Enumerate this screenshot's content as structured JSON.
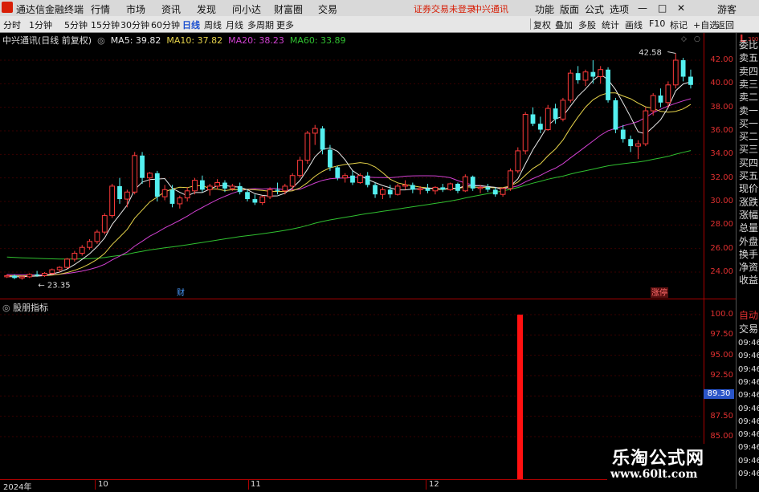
{
  "menubar": {
    "app_title": "通达信金融终端",
    "items": [
      "行情",
      "市场",
      "资讯",
      "发现",
      "问小达",
      "财富圈",
      "交易"
    ],
    "status_warning": "证券交易未登录",
    "stock_name": "中兴通讯",
    "right_items": [
      "功能",
      "版面",
      "公式",
      "选项"
    ],
    "guest": "游客"
  },
  "toolbar": {
    "periods": [
      "分时",
      "1分钟",
      "5分钟",
      "15分钟",
      "30分钟",
      "60分钟",
      "日线",
      "周线",
      "月线",
      "多周期",
      "更多"
    ],
    "right_buttons": [
      "复权",
      "叠加",
      "多股",
      "统计",
      "画线",
      "F10",
      "标记",
      "+自选",
      "返回"
    ],
    "active_period": "日线"
  },
  "main_chart": {
    "title": "中兴通讯(日线 前复权)",
    "ma": [
      {
        "label": "MA5: 39.82",
        "color": "#e8e8e8"
      },
      {
        "label": "MA10: 37.82",
        "color": "#e6d34a"
      },
      {
        "label": "MA20: 38.23",
        "color": "#d040d0"
      },
      {
        "label": "MA60: 33.89",
        "color": "#30c030"
      }
    ],
    "high_label": "42.58",
    "low_label": "23.35",
    "event_marks": [
      "财",
      "涨停"
    ],
    "price_ticks": [
      "42.00",
      "40.00",
      "38.00",
      "36.00",
      "34.00",
      "32.00",
      "30.00",
      "28.00",
      "26.00",
      "24.00"
    ]
  },
  "indicator": {
    "title": "股朋指标",
    "ticks": [
      "100.0",
      "97.50",
      "95.00",
      "92.50",
      "90.00",
      "87.50",
      "85.00"
    ],
    "current_value": "89.30"
  },
  "side_panel": {
    "order_book": [
      "委比",
      "卖五",
      "卖四",
      "卖三",
      "卖二",
      "卖一",
      "买一",
      "买二",
      "买三",
      "买四",
      "买五",
      "现价",
      "涨跌",
      "涨幅",
      "总量",
      "外盘",
      "换手",
      "净资",
      "收益"
    ],
    "lower": [
      "自动",
      "交易"
    ],
    "times": [
      "09:46",
      "09:46",
      "09:46",
      "09:46",
      "09:46",
      "09:46",
      "09:46",
      "09:46",
      "09:46",
      "09:46",
      "09:46"
    ],
    "top_badge": "L",
    "top_code": "300"
  },
  "date_axis": [
    "2024年",
    "10",
    "11",
    "12"
  ],
  "watermark": {
    "line1": "乐淘公式网",
    "line2": "www.60lt.com"
  },
  "chart_data": {
    "type": "candlestick",
    "title": "中兴通讯(日线 前复权)",
    "ylim": [
      22.5,
      43.5
    ],
    "candles": [
      [
        23.6,
        23.8,
        23.5,
        23.7
      ],
      [
        23.7,
        23.8,
        23.4,
        23.5
      ],
      [
        23.5,
        23.7,
        23.35,
        23.6
      ],
      [
        23.6,
        23.9,
        23.5,
        23.8
      ],
      [
        23.8,
        24.1,
        23.6,
        23.7
      ],
      [
        23.7,
        24.0,
        23.6,
        23.9
      ],
      [
        23.9,
        24.3,
        23.8,
        24.2
      ],
      [
        24.2,
        24.5,
        24.0,
        24.4
      ],
      [
        24.4,
        25.2,
        24.3,
        25.1
      ],
      [
        25.1,
        25.8,
        24.9,
        25.6
      ],
      [
        25.6,
        26.3,
        25.4,
        26.1
      ],
      [
        26.1,
        26.8,
        25.9,
        26.6
      ],
      [
        26.6,
        27.6,
        26.4,
        27.4
      ],
      [
        27.4,
        29.0,
        27.2,
        28.8
      ],
      [
        28.8,
        31.5,
        28.6,
        31.3
      ],
      [
        31.3,
        32.0,
        29.8,
        30.2
      ],
      [
        30.2,
        31.0,
        29.5,
        30.8
      ],
      [
        30.8,
        34.2,
        30.6,
        33.9
      ],
      [
        33.9,
        34.2,
        31.5,
        32.0
      ],
      [
        32.0,
        32.5,
        31.2,
        32.4
      ],
      [
        32.4,
        32.6,
        30.0,
        30.4
      ],
      [
        30.4,
        31.4,
        30.1,
        31.0
      ],
      [
        31.0,
        31.4,
        29.5,
        29.8
      ],
      [
        29.8,
        30.5,
        29.4,
        30.3
      ],
      [
        30.3,
        31.2,
        30.0,
        30.9
      ],
      [
        30.9,
        32.0,
        30.6,
        31.8
      ],
      [
        31.8,
        32.2,
        30.8,
        31.0
      ],
      [
        31.0,
        31.5,
        30.5,
        31.3
      ],
      [
        31.3,
        31.9,
        31.0,
        31.6
      ],
      [
        31.6,
        31.8,
        30.8,
        31.1
      ],
      [
        31.1,
        31.5,
        30.9,
        31.3
      ],
      [
        31.3,
        31.6,
        30.6,
        30.8
      ],
      [
        30.8,
        31.0,
        30.0,
        30.2
      ],
      [
        30.2,
        30.6,
        29.7,
        29.9
      ],
      [
        29.9,
        30.5,
        29.7,
        30.4
      ],
      [
        30.4,
        31.2,
        30.2,
        31.0
      ],
      [
        31.0,
        31.6,
        30.6,
        30.9
      ],
      [
        30.9,
        31.5,
        30.6,
        31.3
      ],
      [
        31.3,
        32.4,
        31.0,
        32.2
      ],
      [
        32.2,
        33.8,
        32.0,
        33.5
      ],
      [
        33.5,
        36.0,
        33.2,
        35.8
      ],
      [
        35.8,
        36.5,
        34.8,
        36.2
      ],
      [
        36.2,
        36.4,
        34.0,
        34.4
      ],
      [
        34.4,
        34.8,
        32.6,
        32.9
      ],
      [
        32.9,
        33.0,
        31.8,
        32.0
      ],
      [
        32.0,
        32.4,
        31.6,
        32.2
      ],
      [
        32.2,
        32.6,
        31.4,
        31.6
      ],
      [
        31.6,
        32.4,
        31.5,
        32.2
      ],
      [
        32.2,
        32.5,
        31.2,
        31.4
      ],
      [
        31.4,
        31.6,
        30.3,
        30.6
      ],
      [
        30.6,
        31.2,
        30.2,
        31.0
      ],
      [
        31.0,
        31.4,
        30.3,
        30.6
      ],
      [
        30.6,
        31.5,
        30.5,
        31.3
      ],
      [
        31.3,
        31.8,
        31.0,
        31.4
      ],
      [
        31.4,
        31.6,
        30.7,
        31.0
      ],
      [
        31.0,
        31.3,
        30.6,
        31.1
      ],
      [
        31.1,
        31.5,
        30.7,
        30.9
      ],
      [
        30.9,
        31.3,
        30.6,
        31.2
      ],
      [
        31.2,
        31.5,
        30.8,
        31.0
      ],
      [
        31.0,
        31.6,
        30.9,
        31.5
      ],
      [
        31.5,
        31.6,
        30.7,
        30.9
      ],
      [
        30.9,
        32.3,
        30.8,
        32.1
      ],
      [
        32.1,
        32.2,
        30.9,
        31.1
      ],
      [
        31.1,
        31.4,
        30.7,
        31.2
      ],
      [
        31.2,
        31.5,
        30.8,
        31.0
      ],
      [
        31.0,
        31.2,
        30.4,
        30.6
      ],
      [
        30.6,
        31.2,
        30.4,
        31.1
      ],
      [
        31.1,
        32.8,
        30.9,
        32.6
      ],
      [
        32.6,
        34.6,
        32.4,
        34.3
      ],
      [
        34.3,
        37.6,
        34.0,
        37.4
      ],
      [
        37.4,
        38.0,
        36.4,
        36.6
      ],
      [
        36.6,
        37.2,
        35.8,
        36.1
      ],
      [
        36.1,
        38.2,
        36.0,
        37.9
      ],
      [
        37.9,
        38.3,
        36.6,
        37.0
      ],
      [
        37.0,
        38.8,
        36.8,
        38.6
      ],
      [
        38.6,
        41.2,
        38.4,
        40.9
      ],
      [
        40.9,
        41.5,
        40.0,
        40.3
      ],
      [
        40.3,
        41.2,
        39.8,
        41.0
      ],
      [
        41.0,
        42.0,
        40.0,
        40.6
      ],
      [
        40.6,
        41.5,
        40.0,
        41.2
      ],
      [
        41.2,
        41.4,
        38.4,
        38.6
      ],
      [
        38.6,
        38.8,
        35.8,
        36.1
      ],
      [
        36.1,
        36.5,
        35.0,
        35.3
      ],
      [
        35.3,
        35.6,
        34.2,
        34.7
      ],
      [
        34.7,
        35.2,
        33.6,
        34.9
      ],
      [
        34.9,
        38.0,
        34.7,
        37.7
      ],
      [
        37.7,
        39.2,
        37.3,
        39.0
      ],
      [
        39.0,
        39.6,
        38.0,
        38.4
      ],
      [
        38.4,
        40.2,
        38.0,
        39.9
      ],
      [
        39.9,
        42.58,
        39.6,
        42.0
      ],
      [
        42.0,
        42.2,
        40.2,
        40.6
      ],
      [
        40.6,
        41.2,
        39.6,
        39.9
      ]
    ],
    "ma_last": {
      "MA5": 39.82,
      "MA10": 37.82,
      "MA20": 38.23,
      "MA60": 33.89
    },
    "indicator_bar": {
      "value": 100.0,
      "position": 0.74
    }
  }
}
